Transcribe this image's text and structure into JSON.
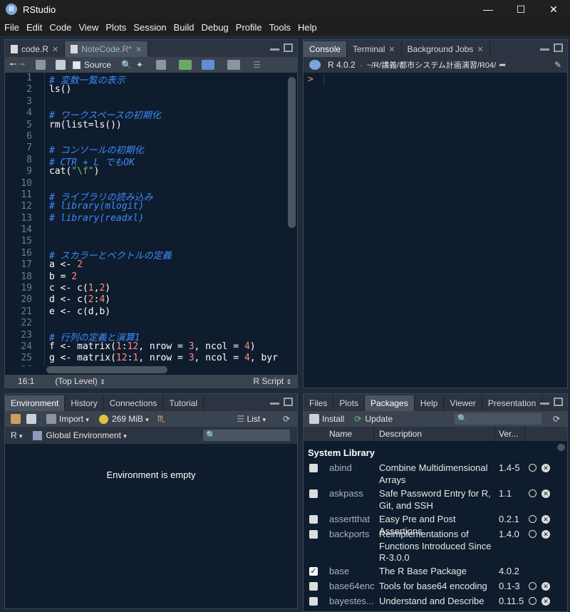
{
  "window": {
    "title": "RStudio",
    "app_letter": "R"
  },
  "menu": [
    "File",
    "Edit",
    "Code",
    "View",
    "Plots",
    "Session",
    "Build",
    "Debug",
    "Profile",
    "Tools",
    "Help"
  ],
  "editor": {
    "tabs": [
      {
        "label": "code.R",
        "active": false
      },
      {
        "label": "NoteCode.R*",
        "active": true
      }
    ],
    "source_label": "Source",
    "lines": [
      {
        "n": "1",
        "parts": [
          {
            "t": "# 変数一覧の表示",
            "c": "cm"
          }
        ]
      },
      {
        "n": "2",
        "parts": [
          {
            "t": "ls()",
            "c": ""
          }
        ]
      },
      {
        "n": "3",
        "parts": []
      },
      {
        "n": "4",
        "parts": [
          {
            "t": "# ワークスペースの初期化",
            "c": "cm"
          }
        ]
      },
      {
        "n": "5",
        "parts": [
          {
            "t": "rm(list=ls())",
            "c": ""
          }
        ]
      },
      {
        "n": "6",
        "parts": []
      },
      {
        "n": "7",
        "parts": [
          {
            "t": "# コンソールの初期化",
            "c": "cm"
          }
        ]
      },
      {
        "n": "8",
        "parts": [
          {
            "t": "# CTR + L でもOK",
            "c": "cm"
          }
        ]
      },
      {
        "n": "9",
        "parts": [
          {
            "t": "cat(",
            "c": ""
          },
          {
            "t": "\"\\f\"",
            "c": "str"
          },
          {
            "t": ")",
            "c": ""
          }
        ]
      },
      {
        "n": "10",
        "parts": []
      },
      {
        "n": "11",
        "parts": [
          {
            "t": "# ライブラリの読み込み",
            "c": "cm"
          }
        ]
      },
      {
        "n": "12",
        "parts": [
          {
            "t": "# library(mlogit)",
            "c": "cm"
          }
        ]
      },
      {
        "n": "13",
        "parts": [
          {
            "t": "# library(readxl)",
            "c": "cm"
          }
        ]
      },
      {
        "n": "14",
        "parts": []
      },
      {
        "n": "15",
        "parts": []
      },
      {
        "n": "16",
        "parts": [
          {
            "t": "# スカラーとベクトルの定義",
            "c": "cm"
          }
        ]
      },
      {
        "n": "17",
        "parts": [
          {
            "t": "a <- ",
            "c": ""
          },
          {
            "t": "2",
            "c": "num"
          }
        ]
      },
      {
        "n": "18",
        "parts": [
          {
            "t": "b = ",
            "c": ""
          },
          {
            "t": "2",
            "c": "num"
          }
        ]
      },
      {
        "n": "19",
        "parts": [
          {
            "t": "c <- c(",
            "c": ""
          },
          {
            "t": "1",
            "c": "num"
          },
          {
            "t": ",",
            "c": ""
          },
          {
            "t": "2",
            "c": "num"
          },
          {
            "t": ")",
            "c": ""
          }
        ]
      },
      {
        "n": "20",
        "parts": [
          {
            "t": "d <- c(",
            "c": ""
          },
          {
            "t": "2",
            "c": "num"
          },
          {
            "t": ":",
            "c": ""
          },
          {
            "t": "4",
            "c": "num"
          },
          {
            "t": ")",
            "c": ""
          }
        ]
      },
      {
        "n": "21",
        "parts": [
          {
            "t": "e <- c(d,b)",
            "c": ""
          }
        ]
      },
      {
        "n": "22",
        "parts": []
      },
      {
        "n": "23",
        "parts": [
          {
            "t": "# 行列の定義と演算1",
            "c": "cm"
          }
        ]
      },
      {
        "n": "24",
        "parts": [
          {
            "t": "f <- matrix(",
            "c": ""
          },
          {
            "t": "1",
            "c": "num"
          },
          {
            "t": ":",
            "c": ""
          },
          {
            "t": "12",
            "c": "num"
          },
          {
            "t": ", nrow = ",
            "c": ""
          },
          {
            "t": "3",
            "c": "num"
          },
          {
            "t": ", ncol = ",
            "c": ""
          },
          {
            "t": "4",
            "c": "num"
          },
          {
            "t": ")",
            "c": ""
          }
        ]
      },
      {
        "n": "25",
        "parts": [
          {
            "t": "g <- matrix(",
            "c": ""
          },
          {
            "t": "12",
            "c": "num"
          },
          {
            "t": ":",
            "c": ""
          },
          {
            "t": "1",
            "c": "num"
          },
          {
            "t": ", nrow = ",
            "c": ""
          },
          {
            "t": "3",
            "c": "num"
          },
          {
            "t": ", ncol = ",
            "c": ""
          },
          {
            "t": "4",
            "c": "num"
          },
          {
            "t": ", byr",
            "c": ""
          }
        ]
      },
      {
        "n": "26",
        "parts": []
      }
    ],
    "status": {
      "position": "16:1",
      "scope": "(Top Level)",
      "filetype": "R Script"
    }
  },
  "console": {
    "tabs": [
      {
        "label": "Console",
        "active": true
      },
      {
        "label": "Terminal",
        "active": false
      },
      {
        "label": "Background Jobs",
        "active": false
      }
    ],
    "r_version": "R 4.0.2",
    "path": "~/R/講義/都市システム計画演習/R04/",
    "prompt": ">"
  },
  "environment": {
    "tabs": [
      {
        "label": "Environment",
        "active": true
      },
      {
        "label": "History",
        "active": false
      },
      {
        "label": "Connections",
        "active": false
      },
      {
        "label": "Tutorial",
        "active": false
      }
    ],
    "import_label": "Import",
    "memory": "269 MiB",
    "list_label": "List",
    "lang": "R",
    "scope": "Global Environment",
    "empty_message": "Environment is empty"
  },
  "packages": {
    "tabs": [
      {
        "label": "Files",
        "active": false
      },
      {
        "label": "Plots",
        "active": false
      },
      {
        "label": "Packages",
        "active": true
      },
      {
        "label": "Help",
        "active": false
      },
      {
        "label": "Viewer",
        "active": false
      },
      {
        "label": "Presentation",
        "active": false
      }
    ],
    "install_label": "Install",
    "update_label": "Update",
    "columns": {
      "name": "Name",
      "description": "Description",
      "version": "Ver..."
    },
    "section": "System Library",
    "rows": [
      {
        "name": "abind",
        "desc": "Combine Multidimensional Arrays",
        "ver": "1.4-5",
        "checked": false,
        "lines": 2,
        "actions": true
      },
      {
        "name": "askpass",
        "desc": "Safe Password Entry for R, Git, and SSH",
        "ver": "1.1",
        "checked": false,
        "lines": 2,
        "actions": true
      },
      {
        "name": "assertthat",
        "desc": "Easy Pre and Post Assertions",
        "ver": "0.2.1",
        "checked": false,
        "lines": 1,
        "actions": true
      },
      {
        "name": "backports",
        "desc": "Reimplementations of Functions Introduced Since R-3.0.0",
        "ver": "1.4.0",
        "checked": false,
        "lines": 3,
        "actions": true
      },
      {
        "name": "base",
        "desc": "The R Base Package",
        "ver": "4.0.2",
        "checked": true,
        "lines": 1,
        "actions": false
      },
      {
        "name": "base64enc",
        "desc": "Tools for base64 encoding",
        "ver": "0.1-3",
        "checked": false,
        "lines": 1,
        "actions": true
      },
      {
        "name": "bayestes...",
        "desc": "Understand and Describe",
        "ver": "0.11.5",
        "checked": false,
        "lines": 1,
        "actions": true
      }
    ]
  },
  "colors": {
    "accent": "#3a8bff",
    "bg": "#0f1c2d",
    "chrome": "#2b3440"
  }
}
